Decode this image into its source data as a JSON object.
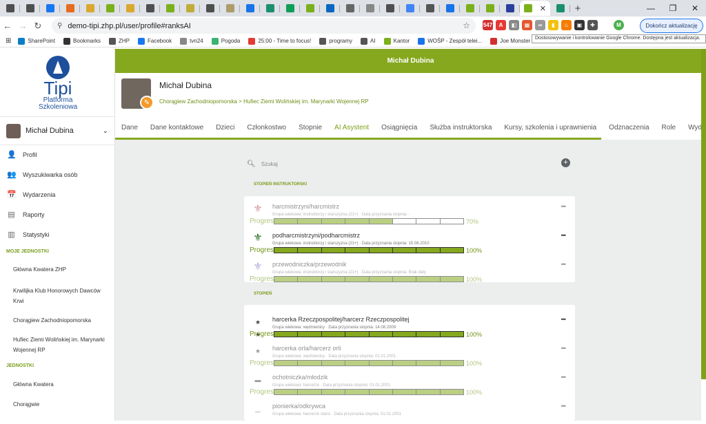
{
  "browser": {
    "tab_colors": [
      "#4f4f4f",
      "#4f4f4f",
      "#1877f2",
      "#e66c1f",
      "#d9a82e",
      "#7bb01c",
      "#d9a82e",
      "#4f4f4f",
      "#7bb01c",
      "#c0ac3a",
      "#4f4f4f",
      "#ac9c6a",
      "#1a73e8",
      "#1c8f6e",
      "#0f9d58",
      "#7bb01c",
      "#0a66c2",
      "#666666",
      "#888888",
      "#4f4f4f",
      "#4285f4",
      "#555555",
      "#1a73e8",
      "#7bb01c",
      "#7bb01c",
      "#2a3f9c",
      "#198f6e"
    ],
    "active_tab_color": "#7bb01c",
    "active_tab_close": "✕",
    "new_tab": "+",
    "win_min": "—",
    "win_max": "❐",
    "win_close": "✕",
    "url": "demo-tipi.zhp.pl/user/profile#ranksAI",
    "update_button": "Dokończ aktualizację",
    "tooltip": "Dostosowywanie i kontrolowanie Google Chrome. Dostępna jest aktualizacja.",
    "badge_count": "547"
  },
  "bookmarks": [
    {
      "label": "SharePoint",
      "color": "#0b7ec4"
    },
    {
      "label": "Bookmarks",
      "color": "#333333"
    },
    {
      "label": "ZHP",
      "color": "#555555"
    },
    {
      "label": "Facebook",
      "color": "#1877f2"
    },
    {
      "label": "tvn24",
      "color": "#888888"
    },
    {
      "label": "Pogoda",
      "color": "#3cb371"
    },
    {
      "label": "25:00 - Time to focus!",
      "color": "#e53935"
    },
    {
      "label": "programy",
      "color": "#555555"
    },
    {
      "label": "AI",
      "color": "#555555"
    },
    {
      "label": "Kantor",
      "color": "#7bb01c"
    },
    {
      "label": "WOŚP - Zespół telei...",
      "color": "#1a73e8"
    },
    {
      "label": "Joe Monster",
      "color": "#d32f2f"
    }
  ],
  "sidebar": {
    "brand": "Tipi",
    "brand_sub1": "Platforma",
    "brand_sub2": "Szkoleniowa",
    "user_name": "Michał Dubina",
    "menu": [
      {
        "label": "Profil",
        "icon": "👤"
      },
      {
        "label": "Wyszukiwarka osób",
        "icon": "👥"
      },
      {
        "label": "Wydarzenia",
        "icon": "📅"
      },
      {
        "label": "Raporty",
        "icon": "▤"
      },
      {
        "label": "Statystyki",
        "icon": "▥"
      }
    ],
    "section_my_units": "MOJE JEDNOSTKI",
    "my_units": [
      "Główna Kwatera ZHP",
      "Krwilijka Klub Honorowych Dawców Krwi",
      "Chorągiew Zachodniopomorska",
      "Hufiec Ziemi Wolińskiej im. Marynarki Wojennej RP"
    ],
    "section_units": "JEDNOSTKI",
    "units": [
      "Główna Kwatera",
      "Chorągwie"
    ]
  },
  "header": {
    "bar_title": "Michał Dubina",
    "name": "Michał Dubina",
    "breadcrumb": "Chorągiew Zachodniopomorska > Hufiec Ziemi Wolińskiej im. Marynarki Wojennej RP",
    "tabs": [
      "Dane",
      "Dane kontaktowe",
      "Dzieci",
      "Członkostwo",
      "Stopnie",
      "AI Asystent",
      "Osiągnięcia",
      "Służba instruktorska",
      "Kursy, szkolenia i uprawnienia",
      "Odznaczenia",
      "Role",
      "Wydarzenia"
    ]
  },
  "content": {
    "search_placeholder": "Szukaj",
    "section_instructor": "STOPIEŃ INSTRUKTORSKI",
    "section_rank": "STOPIEŃ",
    "progress_label": "Progres",
    "instructor_items": [
      {
        "title": "harcmistrzyni/harcmistrz",
        "meta": "Grupa wiekowa: instruktorzy i starszyzna (21+) · Data przyznania stopnia: -",
        "percent": "70%",
        "filled": 5,
        "icon_color": "#b0404a",
        "faded": true
      },
      {
        "title": "podharcmistrzyni/podharcmistrz",
        "meta": "Grupa wiekowa: instruktorzy i starszyzna (21+) · Data przyznania stopnia: 15.06.2010",
        "percent": "100%",
        "filled": 8,
        "icon_color": "#1e6b1e",
        "faded": false
      },
      {
        "title": "przewodniczka/przewodnik",
        "meta": "Grupa wiekowa: instruktorzy i starszyzna (21+) · Data przyznania stopnia: Brak daty",
        "percent": "100%",
        "filled": 8,
        "icon_color": "#6a6ac0",
        "faded": true
      }
    ],
    "rank_items": [
      {
        "title": "harcerka Rzeczpospolitej/harcerz Rzeczpospolitej",
        "meta": "Grupa wiekowa: wędrownicy · Data przyznania stopnia: 14.08.2009",
        "percent": "100%",
        "filled": 8,
        "icon": "★ ★",
        "faded": false
      },
      {
        "title": "harcerka orla/harcerz orli",
        "meta": "Grupa wiekowa: wędrownicy · Data przyznania stopnia: 01.01.2001",
        "percent": "100%",
        "filled": 8,
        "icon": "★",
        "faded": true
      },
      {
        "title": "ochotniczka/młodzik",
        "meta": "Grupa wiekowa: harcerze · Data przyznania stopnia: 01.01.2001",
        "percent": "100%",
        "filled": 8,
        "icon": "▬",
        "faded": true
      },
      {
        "title": "pionierka/odkrywca",
        "meta": "Grupa wiekowa: harcerze starsi · Data przyznania stopnia: 01.01.2001",
        "icon": "‿",
        "faded": true
      }
    ]
  }
}
